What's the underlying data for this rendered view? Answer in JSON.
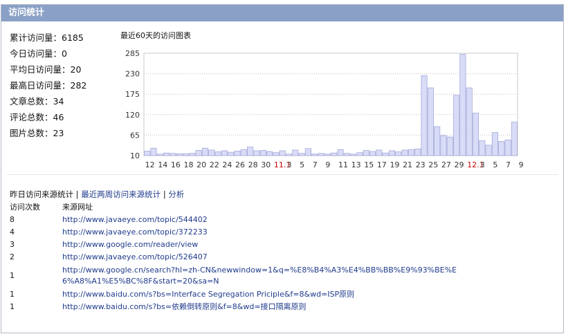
{
  "panel": {
    "title": "访问统计"
  },
  "stats": [
    {
      "label": "累计访问量：",
      "value": "6185"
    },
    {
      "label": "今日访问量：",
      "value": "0"
    },
    {
      "label": "平均日访问量：",
      "value": "20"
    },
    {
      "label": "最高日访问量：",
      "value": "282"
    },
    {
      "label": "文章总数：",
      "value": "34"
    },
    {
      "label": "评论总数：",
      "value": "46"
    },
    {
      "label": "图片总数：",
      "value": "23"
    }
  ],
  "chart_title": "最近60天的访问图表",
  "chart_data": {
    "type": "bar",
    "ylim": [
      10,
      285
    ],
    "yticks": [
      10,
      65,
      120,
      175,
      230,
      285
    ],
    "grid": true,
    "values": [
      22,
      30,
      14,
      17,
      16,
      15,
      15,
      16,
      24,
      30,
      25,
      20,
      23,
      19,
      22,
      26,
      33,
      23,
      24,
      21,
      18,
      23,
      14,
      25,
      16,
      29,
      14,
      16,
      14,
      17,
      26,
      16,
      14,
      18,
      24,
      21,
      25,
      17,
      23,
      20,
      25,
      26,
      28,
      225,
      192,
      88,
      64,
      60,
      172,
      282,
      192,
      124,
      50,
      38,
      72,
      48,
      52,
      100
    ],
    "xlabels": [
      {
        "text": "12",
        "red": false
      },
      {
        "text": "14",
        "red": false
      },
      {
        "text": "16",
        "red": false
      },
      {
        "text": "18",
        "red": false
      },
      {
        "text": "20",
        "red": false
      },
      {
        "text": "22",
        "red": false
      },
      {
        "text": "24",
        "red": false
      },
      {
        "text": "26",
        "red": false
      },
      {
        "text": "28",
        "red": false
      },
      {
        "text": "30",
        "red": false
      },
      {
        "text": "11.1",
        "red": true
      },
      {
        "text": "3",
        "red": false
      },
      {
        "text": "5",
        "red": false
      },
      {
        "text": "7",
        "red": false
      },
      {
        "text": "9",
        "red": false
      },
      {
        "text": "11",
        "red": false
      },
      {
        "text": "13",
        "red": false
      },
      {
        "text": "15",
        "red": false
      },
      {
        "text": "17",
        "red": false
      },
      {
        "text": "19",
        "red": false
      },
      {
        "text": "21",
        "red": false
      },
      {
        "text": "23",
        "red": false
      },
      {
        "text": "25",
        "red": false
      },
      {
        "text": "27",
        "red": false
      },
      {
        "text": "29",
        "red": false
      },
      {
        "text": "12.1",
        "red": true
      },
      {
        "text": "3",
        "red": false
      },
      {
        "text": "5",
        "red": false
      },
      {
        "text": "7",
        "red": false
      },
      {
        "text": "9",
        "red": false
      }
    ],
    "colors": {
      "bar_fill": "#d9dcf7",
      "bar_stroke": "#a3a8d8",
      "grid": "#bdbdbd",
      "red_label": "#cc0000"
    }
  },
  "links": {
    "current": "昨日访问来源统计",
    "sep": " | ",
    "two_weeks": "最近两周访问来源统计",
    "analysis": "分析"
  },
  "table": {
    "headers": [
      "访问次数",
      "来源网址"
    ],
    "rows": [
      {
        "count": "8",
        "url": "http://www.javaeye.com/topic/544402"
      },
      {
        "count": "4",
        "url": "http://www.javaeye.com/topic/372233"
      },
      {
        "count": "3",
        "url": "http://www.google.com/reader/view"
      },
      {
        "count": "2",
        "url": "http://www.javaeye.com/topic/526407"
      },
      {
        "count": "1",
        "url": "http://www.google.cn/search?hl=zh-CN&newwindow=1&q=%E8%B4%A3%E4%BB%BB%E9%93%BE%E6%A8%A1%E5%BC%8F&start=20&sa=N"
      },
      {
        "count": "1",
        "url": "http://www.baidu.com/s?bs=Interface Segregation Priciple&f=8&wd=ISP原则"
      },
      {
        "count": "1",
        "url": "http://www.baidu.com/s?bs=依赖倒转原则&f=8&wd=接口隔离原则"
      }
    ]
  }
}
